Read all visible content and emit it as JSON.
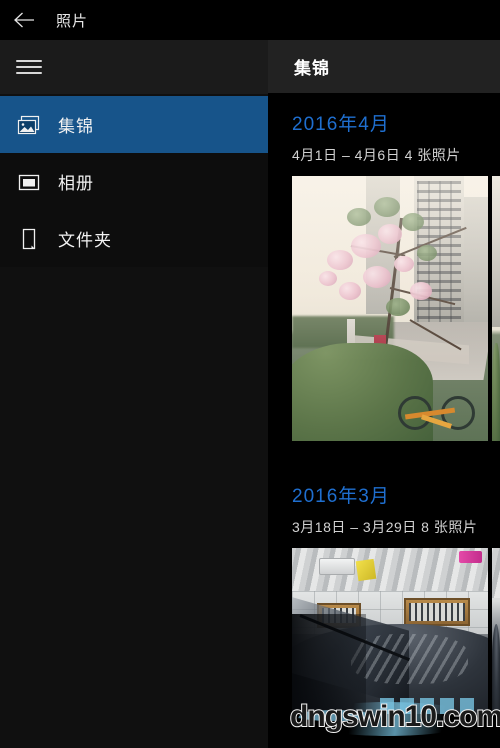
{
  "titlebar": {
    "back_icon": "back-arrow-icon",
    "title": "照片"
  },
  "sidebar": {
    "menu_icon": "hamburger-menu-icon",
    "items": [
      {
        "label": "集锦",
        "icon": "collection-icon",
        "selected": true
      },
      {
        "label": "相册",
        "icon": "album-icon",
        "selected": false
      },
      {
        "label": "文件夹",
        "icon": "folder-icon",
        "selected": false
      }
    ]
  },
  "content": {
    "header_title": "集锦",
    "groups": [
      {
        "title": "2016年4月",
        "subtitle": "4月1日 – 4月6日   4 张照片",
        "photos": [
          {
            "name": "photo-street-cherry-blossom"
          },
          {
            "name": "photo-next-partial"
          }
        ]
      },
      {
        "title": "2016年3月",
        "subtitle": "3月18日 – 3月29日   8 张照片",
        "photos": [
          {
            "name": "photo-garage-car"
          },
          {
            "name": "photo-next-partial"
          }
        ]
      }
    ]
  },
  "watermark": {
    "text": "dngswin10.com"
  },
  "colors": {
    "accent_selected": "#17548a",
    "heading_blue": "#1f6fd0",
    "sidebar_bg": "#0d0d0d",
    "sidebar_header_bg": "#1b1b1b",
    "content_bg": "#000000",
    "content_header_bg": "#222222",
    "titlebar_bg": "#000000",
    "text_primary": "#f2f2f2",
    "text_secondary": "#d2d2d2"
  }
}
